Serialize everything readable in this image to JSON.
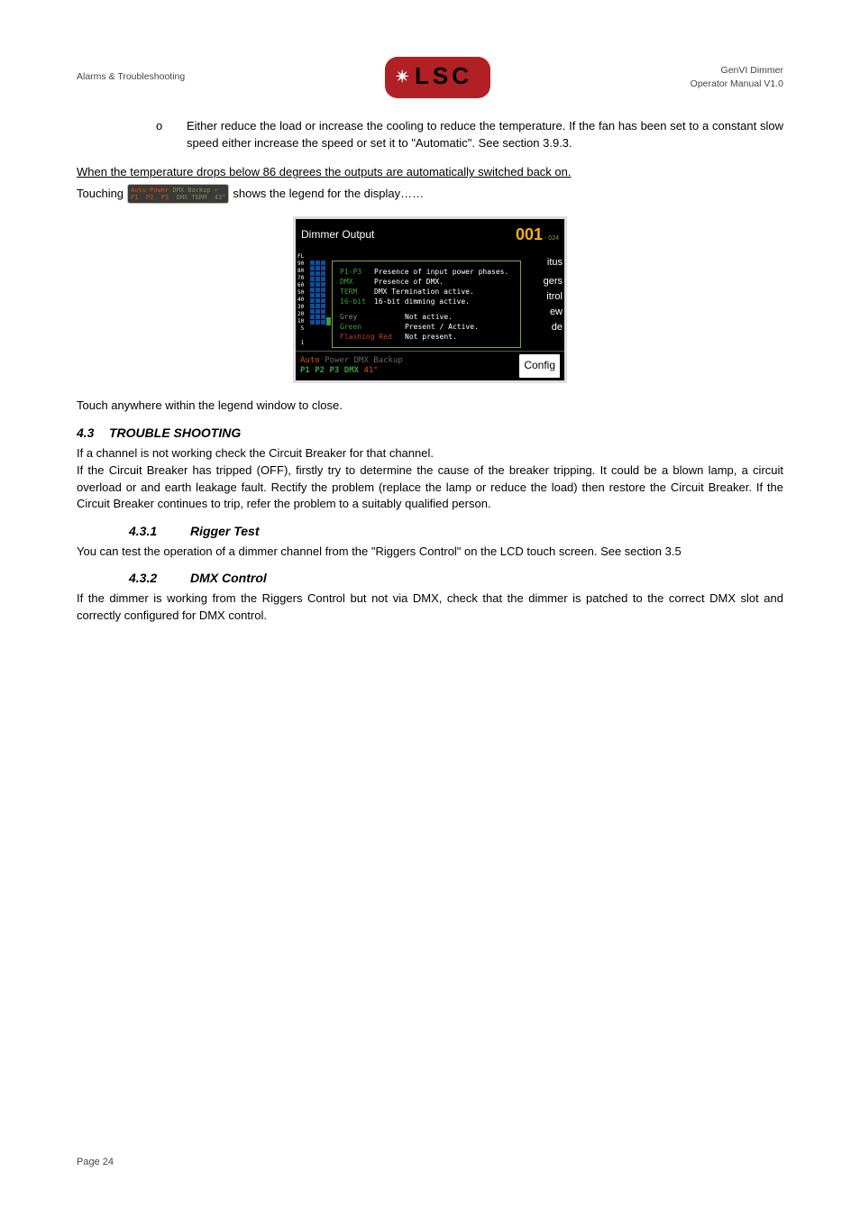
{
  "header": {
    "left": "Alarms & Troubleshooting",
    "right_line1": "GenVI Dimmer",
    "right_line2": "Operator Manual V1.0",
    "logo_text": "LSC"
  },
  "content": {
    "bullet_text": "Either reduce the load or increase the cooling to reduce the temperature. If the fan has been set to a constant slow speed either increase the speed or set it to \"Automatic\". See section 3.9.3.",
    "underlined_text": "When the temperature drops below 86 degrees the outputs are automatically switched back on.",
    "touching_before": "Touching",
    "touching_after": " shows the legend for the display……",
    "mini_btn_line1a": "Auto Power",
    "mini_btn_line1b": " DMX Backup ☼",
    "mini_btn_line2a": "P1  P2  P3  ",
    "mini_btn_line2b": "DMX TERM  43°",
    "touch_anywhere": "Touch anywhere within the legend window to close.",
    "sec43_num": "4.3",
    "sec43_title": "TROUBLE SHOOTING",
    "sec43_p1": "If a channel is not working check the Circuit Breaker for that channel.",
    "sec43_p2": "If the Circuit Breaker has tripped (OFF), firstly try to determine the cause of the breaker tripping. It could be a blown lamp, a circuit overload or and earth leakage fault. Rectify the problem (replace the lamp or reduce the load) then restore the Circuit Breaker. If the Circuit Breaker continues to trip, refer the problem to a suitably qualified person.",
    "sec431_num": "4.3.1",
    "sec431_title": "Rigger Test",
    "sec431_text": "You can test the operation of a dimmer channel from the \"Riggers Control\" on the LCD touch screen. See section 3.5",
    "sec432_num": "4.3.2",
    "sec432_title": "DMX Control",
    "sec432_text": "If the dimmer is working from the Riggers Control but not via DMX, check that the dimmer is patched to the correct DMX slot and correctly configured for DMX control."
  },
  "screenshot": {
    "title": "Dimmer Output",
    "number": "001",
    "numsub": "- 024",
    "scale": "FL\n90\n80\n70\n60\n50\n40\n30\n20\n10\n 5\n\n 1",
    "legend": {
      "l1_lbl": "P1-P3",
      "l1_txt": "Presence of input power phases.",
      "l2_lbl": "DMX",
      "l2_txt": "Presence of DMX.",
      "l3_lbl": "TERM",
      "l3_txt": "DMX Termination active.",
      "l4_lbl": "16-bit",
      "l4_txt": "16-bit dimming active.",
      "c1_lbl": "Grey",
      "c1_txt": "Not active.",
      "c2_lbl": "Green",
      "c2_txt": "Present / Active.",
      "c3_lbl": "Flashing Red",
      "c3_txt": "Not present."
    },
    "right_labels": {
      "r1": "itus",
      "r2": "gers",
      "r3": "itrol",
      "r4": "ew",
      "r5": "de"
    },
    "footer": {
      "line1_a": "Auto",
      "line1_b": " Power",
      "line1_c": "   DMX Backup",
      "line2_a": "P1   P2   P3",
      "line2_b": "     DMX",
      "line2_c": "          41°",
      "config": "Config"
    }
  },
  "footer": {
    "page": "Page 24"
  }
}
